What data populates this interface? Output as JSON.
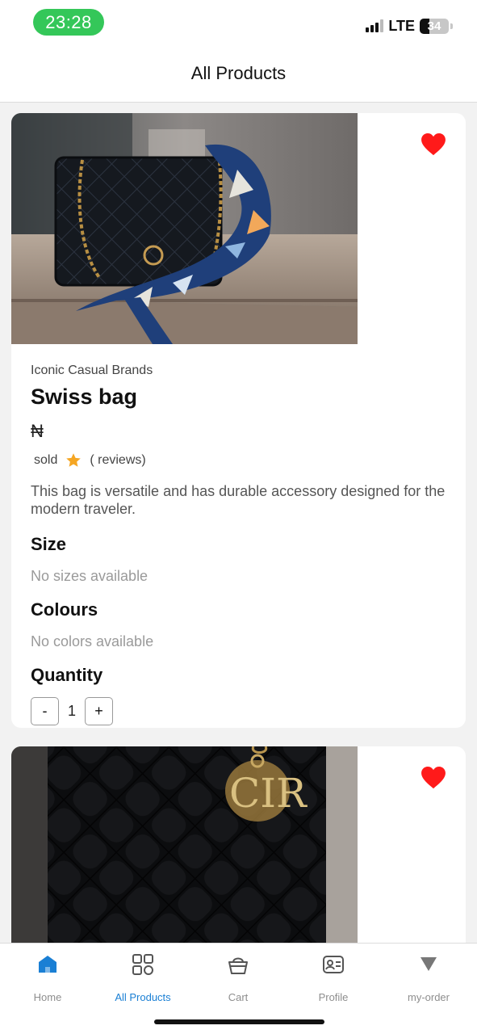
{
  "status_bar": {
    "time": "23:28",
    "network": "LTE",
    "battery": "34",
    "battery_level": 0.34,
    "time_pill_color": "#34c759"
  },
  "header": {
    "title": "All Products"
  },
  "products": [
    {
      "image": "black quilted handbag with chain strap and blue silk scarf",
      "favorite": true,
      "brand": "Iconic Casual Brands",
      "title": "Swiss bag",
      "price": "₦",
      "sold_label": "sold",
      "reviews_label": "( reviews)",
      "description": "This bag is versatile and has durable accessory designed for the modern traveler.",
      "size_heading": "Size",
      "size_value": "No sizes available",
      "colours_heading": "Colours",
      "colours_value": "No colors available",
      "quantity_heading": "Quantity",
      "qty_minus": "-",
      "quantity": "1",
      "qty_plus": "+"
    },
    {
      "image": "black quilted leather bag with gold letter charm",
      "favorite": true
    }
  ],
  "tabbar": {
    "items": [
      {
        "label": "Home",
        "icon": "home-icon",
        "active": false
      },
      {
        "label": "All Products",
        "icon": "grid-icon",
        "active": true
      },
      {
        "label": "Cart",
        "icon": "basket-icon",
        "active": false
      },
      {
        "label": "Profile",
        "icon": "id-card-icon",
        "active": false
      },
      {
        "label": "my-order",
        "icon": "triangle-down-icon",
        "active": false
      }
    ]
  },
  "colors": {
    "accent": "#1a7fd4",
    "heart": "#ff1a1a",
    "star": "#f5a623"
  }
}
